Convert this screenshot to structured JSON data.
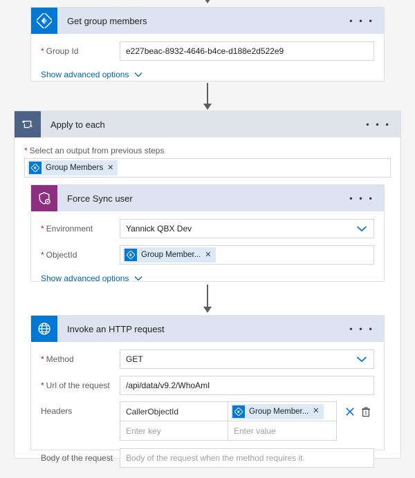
{
  "flow": {
    "connectors": [
      {
        "name": "connector-top-partial"
      },
      {
        "name": "connector-get-group-members-to-apply-to-each"
      },
      {
        "name": "connector-force-sync-to-http"
      }
    ]
  },
  "cards": {
    "get_group_members": {
      "title": "Get group members",
      "icon": "azure-ad-icon",
      "overflow_label": "• • •",
      "fields": [
        {
          "label": "Group Id",
          "required": true,
          "value": "e227beac-8932-4646-b4ce-d188e2d522e9"
        }
      ],
      "advanced_label": "Show advanced options"
    },
    "apply_to_each": {
      "title": "Apply to each",
      "icon": "loop-icon",
      "overflow_label": "• • •",
      "select_output_label": "Select an output from previous steps",
      "select_output_required": true,
      "token": {
        "label": "Group Members",
        "icon": "azure-ad-icon",
        "remove_label": "✕"
      }
    },
    "force_sync_user": {
      "title": "Force Sync user",
      "icon": "shield-sync-icon",
      "overflow_label": "• • •",
      "environment": {
        "label": "Environment",
        "required": true,
        "value": "Yannick QBX Dev"
      },
      "object_id": {
        "label": "ObjectId",
        "required": true,
        "token": {
          "label": "Group Member...",
          "icon": "azure-ad-icon",
          "remove_label": "✕"
        }
      },
      "advanced_label": "Show advanced options"
    },
    "invoke_http_request": {
      "title": "Invoke an HTTP request",
      "icon": "globe-icon",
      "overflow_label": "• • •",
      "method": {
        "label": "Method",
        "required": true,
        "value": "GET"
      },
      "url": {
        "label": "Url of the request",
        "required": true,
        "value": "/api/data/v9.2/WhoAmI"
      },
      "headers": {
        "label": "Headers",
        "required": false,
        "rows": [
          {
            "key": "CallerObjectId",
            "value_token": {
              "label": "Group Member...",
              "icon": "azure-ad-icon",
              "remove_label": "✕"
            },
            "actions": [
              "clear-icon",
              "delete-icon"
            ]
          },
          {
            "key_placeholder": "Enter key",
            "value_placeholder": "Enter value"
          }
        ]
      },
      "body": {
        "label": "Body of the request",
        "required": false,
        "placeholder": "Body of the request when the method requires it."
      }
    }
  },
  "colors": {
    "accent_blue": "#0078d4",
    "header_blue": "#dce4f2",
    "slate_tile": "#4c6286",
    "purple_tile": "#8c2f80",
    "required_red": "#a4262c",
    "link_blue": "#0063b1",
    "page_bg": "#f5f5f5",
    "token_bg": "#dce9f7"
  }
}
